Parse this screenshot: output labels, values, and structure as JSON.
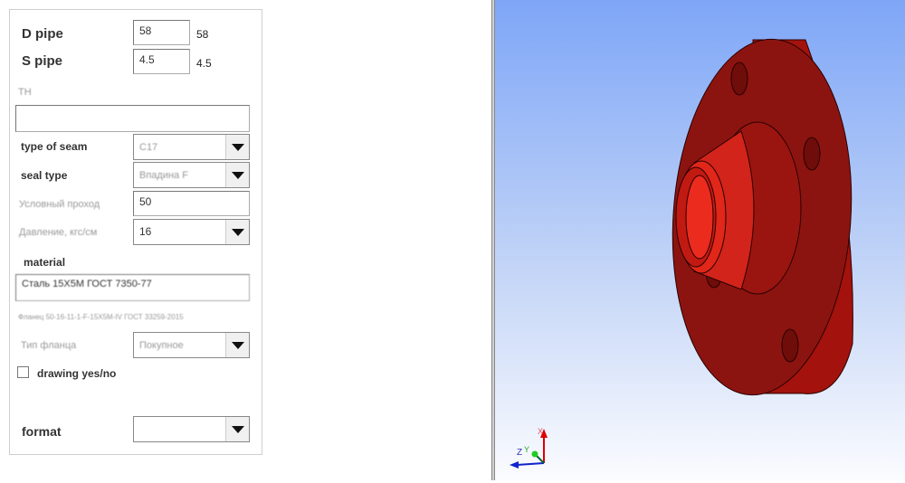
{
  "form": {
    "d_pipe": {
      "label": "D pipe",
      "value": "58",
      "display": "58"
    },
    "s_pipe": {
      "label": "S pipe",
      "value": "4.5",
      "display": "4.5"
    },
    "th": {
      "label": "TH",
      "value": ""
    },
    "type_of_seam": {
      "label": "type of seam",
      "value": "C17"
    },
    "seal_type": {
      "label": "seal type",
      "value": "Впадина F"
    },
    "nominal_bore": {
      "label": "Условный проход",
      "value": "50"
    },
    "pressure": {
      "label": "Давление, кгс/см",
      "value": "16"
    },
    "material": {
      "label": "material",
      "value": "Сталь 15Х5М ГОСТ 7350-77"
    },
    "designation": "Фланец 50-16-11-1-F-15Х5М-IV ГОСТ 33259-2015",
    "flange_type": {
      "label": "Тип фланца",
      "value": "Покупное"
    },
    "drawing": {
      "label": "drawing yes/no",
      "checked": false
    },
    "format": {
      "label": "format",
      "value": ""
    }
  },
  "viewport": {
    "model_color": "#c0150f",
    "axes": {
      "x": "X",
      "y": "Y",
      "z": "Z"
    }
  }
}
